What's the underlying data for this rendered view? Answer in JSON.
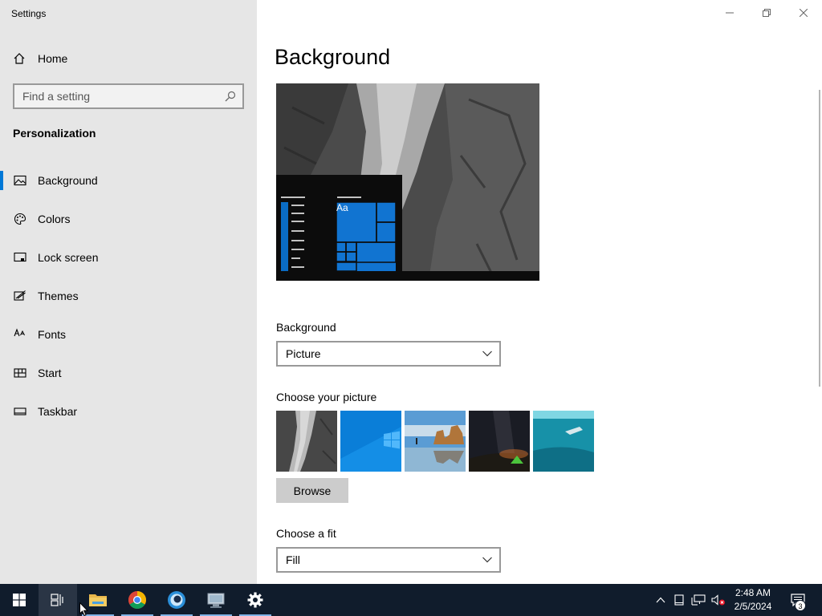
{
  "window": {
    "title": "Settings"
  },
  "sidebar": {
    "home_label": "Home",
    "search_placeholder": "Find a setting",
    "section_title": "Personalization",
    "items": [
      {
        "label": "Background",
        "icon": "picture-icon",
        "selected": true
      },
      {
        "label": "Colors",
        "icon": "palette-icon",
        "selected": false
      },
      {
        "label": "Lock screen",
        "icon": "lock-screen-icon",
        "selected": false
      },
      {
        "label": "Themes",
        "icon": "themes-icon",
        "selected": false
      },
      {
        "label": "Fonts",
        "icon": "fonts-icon",
        "selected": false
      },
      {
        "label": "Start",
        "icon": "start-icon",
        "selected": false
      },
      {
        "label": "Taskbar",
        "icon": "taskbar-icon",
        "selected": false
      }
    ]
  },
  "main": {
    "page_title": "Background",
    "preview": {
      "tile_label": "Aa"
    },
    "background_label": "Background",
    "background_value": "Picture",
    "choose_picture_label": "Choose your picture",
    "thumbnails": [
      "rock-face",
      "windows-blue",
      "beach-rocks",
      "night-sky-tent",
      "underwater-swimmer"
    ],
    "browse_label": "Browse",
    "fit_label": "Choose a fit",
    "fit_value": "Fill"
  },
  "taskbar": {
    "apps": [
      "start-button",
      "task-view",
      "file-explorer",
      "chrome",
      "app-blue-circle",
      "remote-desktop",
      "settings"
    ],
    "time": "2:48 AM",
    "date": "2/5/2024",
    "notification_count": "3"
  },
  "colors": {
    "accent": "#0078d7",
    "sidebar_bg": "#e6e6e6",
    "taskbar_bg": "#101c2c"
  }
}
